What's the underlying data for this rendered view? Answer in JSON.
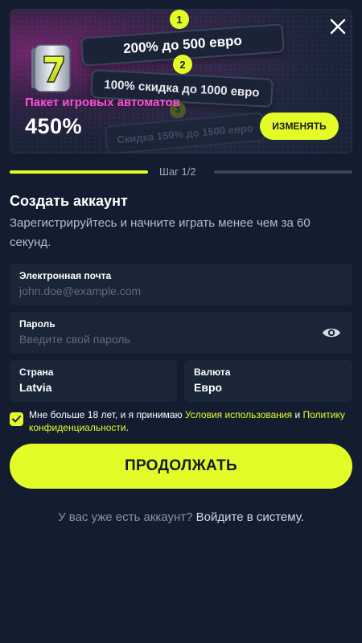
{
  "banner": {
    "tiers": [
      {
        "number": "1",
        "text": "200% до 500 евро"
      },
      {
        "number": "2",
        "text": "100% скидка до 1000 евро"
      },
      {
        "number": "3",
        "text": "Скидка 150% до 1500 евро"
      }
    ],
    "package_label": "Пакет игровых автоматов",
    "package_percent": "450%",
    "change_button": "ИЗМЕНЯТЬ",
    "close_icon": "close-icon",
    "slot_icon": "slot-seven-icon"
  },
  "progress": {
    "step_label": "Шаг 1/2",
    "fraction": 0.5
  },
  "form": {
    "title": "Создать аккаунт",
    "subtitle": "Зарегистрируйтесь и начните играть менее чем за 60 секунд.",
    "email": {
      "label": "Электронная почта",
      "placeholder": "john.doe@example.com",
      "value": ""
    },
    "password": {
      "label": "Пароль",
      "placeholder": "Введите свой пароль",
      "value": "",
      "icon": "eye-icon"
    },
    "country": {
      "label": "Страна",
      "value": "Latvia"
    },
    "currency": {
      "label": "Валюта",
      "value": "Евро"
    },
    "consent": {
      "checked": true,
      "text_before": "Мне больше 18 лет, и я принимаю ",
      "terms_link": "Условия использования",
      "text_and": " и ",
      "privacy_link": "Политику конфиденциальности",
      "text_after": "."
    },
    "continue_button": "ПРОДОЛЖАТЬ",
    "login_prompt": "У вас уже есть аккаунт?",
    "login_link": "Войдите в систему."
  },
  "colors": {
    "background": "#131d2f",
    "accent": "#e3fc27",
    "field_bg": "#1b2538",
    "pink": "#ff4fd8"
  }
}
